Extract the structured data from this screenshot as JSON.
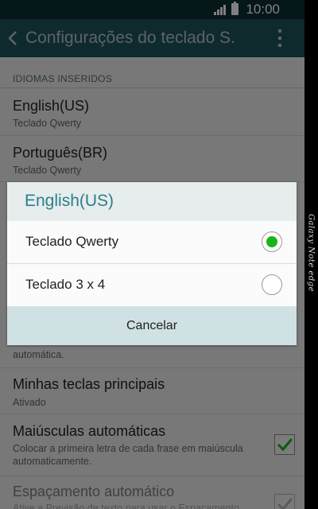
{
  "status": {
    "time": "10:00"
  },
  "actionbar": {
    "title": "Configurações do teclado S."
  },
  "section": {
    "header": "IDIOMAS INSERIDOS"
  },
  "languages": [
    {
      "title": "English(US)",
      "subtitle": "Teclado Qwerty"
    },
    {
      "title": "Português(BR)",
      "subtitle": "Teclado Qwerty"
    }
  ],
  "settings": {
    "partial_subtitle": "automática.",
    "main_keys": {
      "title": "Minhas teclas principais",
      "subtitle": "Ativado"
    },
    "auto_caps": {
      "title": "Maiúsculas automáticas",
      "subtitle": "Colocar a primeira letra de cada frase em maiúscula automaticamente.",
      "checked": true
    },
    "auto_space": {
      "title": "Espaçamento automático",
      "subtitle": "Ative a Previsão de texto para usar o Espaçamento",
      "checked": true
    }
  },
  "dialog": {
    "title": "English(US)",
    "options": [
      {
        "label": "Teclado Qwerty",
        "selected": true
      },
      {
        "label": "Teclado 3 x 4",
        "selected": false
      }
    ],
    "cancel_label": "Cancelar"
  },
  "device": {
    "edge_label": "Galaxy Note edge"
  },
  "colors": {
    "accent": "#2a7f8d",
    "radio_on": "#18b51a",
    "check": "#18b51a",
    "actionbar": "#1e545b",
    "statusbar": "#0c2f34"
  }
}
